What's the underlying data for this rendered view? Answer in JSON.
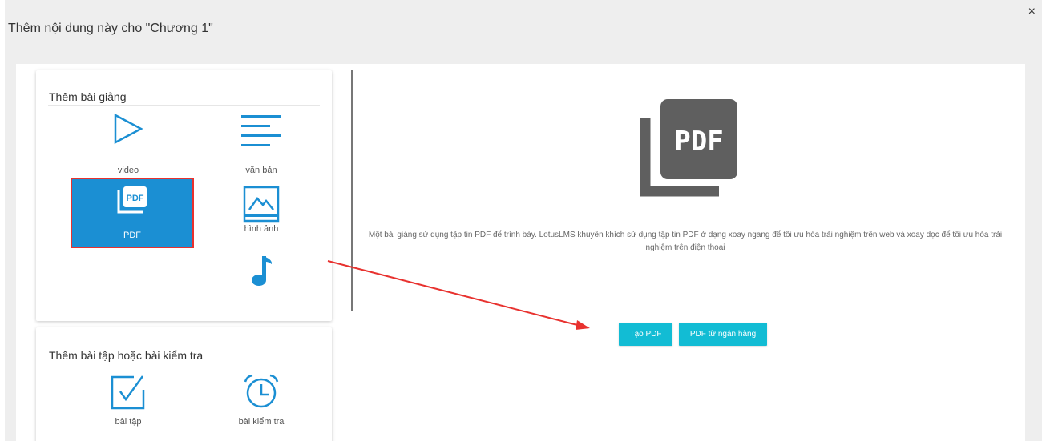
{
  "modal": {
    "title": "Thêm nội dung này cho \"Chương 1\"",
    "close": "×"
  },
  "lecture_section": {
    "title": "Thêm bài giảng",
    "tiles": [
      {
        "label": "video",
        "icon": "play-icon"
      },
      {
        "label": "văn bản",
        "icon": "text-lines-icon"
      },
      {
        "label": "PDF",
        "icon": "pdf-icon",
        "selected": true
      },
      {
        "label": "hình ảnh",
        "icon": "image-icon"
      },
      {
        "label": "",
        "icon": "music-note-icon"
      }
    ]
  },
  "exercise_section": {
    "title": "Thêm bài tập hoặc bài kiểm tra",
    "tiles": [
      {
        "label": "bài tập",
        "icon": "checkbox-icon"
      },
      {
        "label": "bài kiểm tra",
        "icon": "alarm-clock-icon"
      }
    ]
  },
  "detail": {
    "icon": "pdf-large-icon",
    "icon_text": "PDF",
    "description": "Một bài giảng sử dụng tập tin PDF để trình bày. LotusLMS khuyến khích sử dụng tập tin PDF ở dạng xoay ngang để tối ưu hóa trải nghiệm trên web và xoay dọc để tối ưu hóa trải nghiệm trên điện thoại",
    "buttons": {
      "create": "Tạo PDF",
      "from_bank": "PDF từ ngân hàng"
    }
  },
  "colors": {
    "accent": "#1b8fd3",
    "button": "#12bcd4",
    "highlight": "#e8322f",
    "icon_dark": "#5f5f5f"
  }
}
